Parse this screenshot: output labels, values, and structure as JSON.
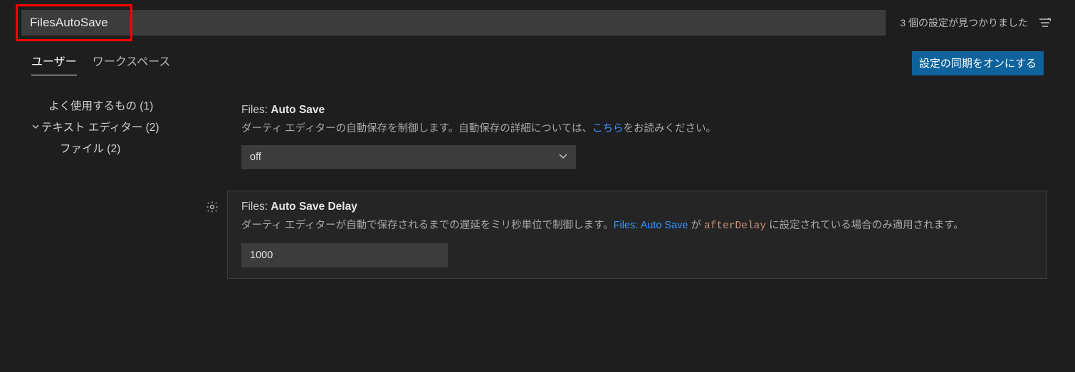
{
  "search": {
    "value": "FilesAutoSave",
    "count_text": "3 個の設定が見つかりました"
  },
  "tabs": {
    "user": "ユーザー",
    "workspace": "ワークスペース"
  },
  "sync_button": "設定の同期をオンにする",
  "sidebar": {
    "frequently_used": "よく使用するもの (1)",
    "text_editor": "テキスト エディター (2)",
    "file": "ファイル (2)"
  },
  "settings": {
    "auto_save": {
      "title_prefix": "Files: ",
      "title_bold": "Auto Save",
      "desc_pre": "ダーティ エディターの自動保存を制御します。自動保存の詳細については、",
      "desc_link": "こちら",
      "desc_post": "をお読みください。",
      "value": "off"
    },
    "auto_save_delay": {
      "title_prefix": "Files: ",
      "title_bold": "Auto Save Delay",
      "desc_pre": "ダーティ エディターが自動で保存されるまでの遅延をミリ秒単位で制御します。",
      "desc_link": "Files: Auto Save",
      "desc_mid": " が ",
      "desc_code": "afterDelay",
      "desc_post": " に設定されている場合のみ適用されます。",
      "value": "1000"
    }
  }
}
